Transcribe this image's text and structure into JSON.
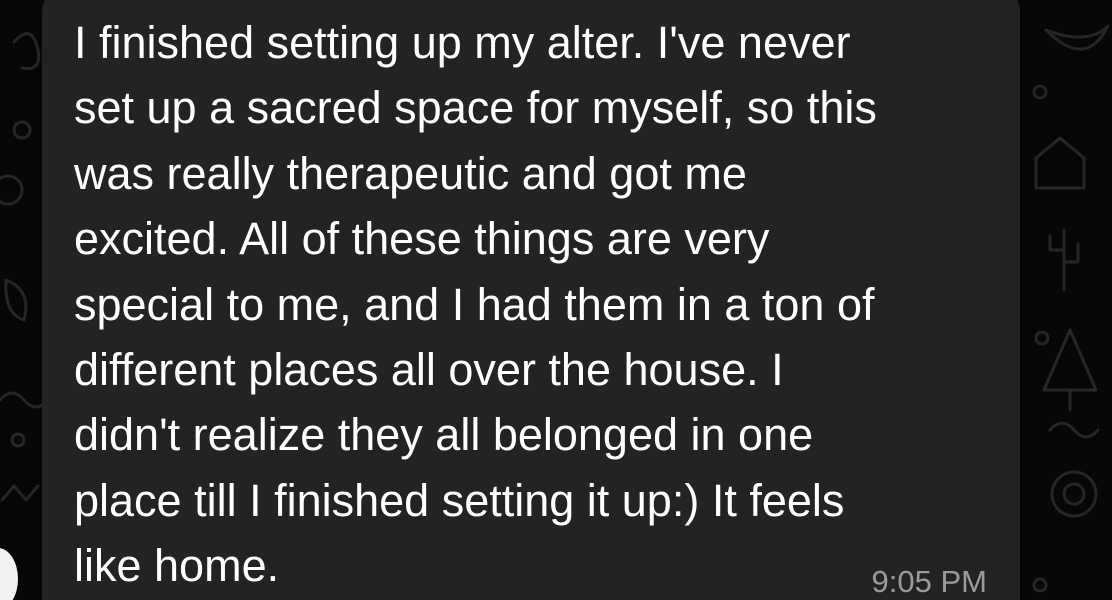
{
  "chat": {
    "message": {
      "lines": [
        "I finished setting up my alter. I've never",
        "set up a sacred space for myself, so this",
        "was really therapeutic and got me",
        "excited. All of these things are very",
        "special to me, and I had them in a ton of",
        "different places all over the house. I",
        "didn't realize they all belonged in one",
        "place till I finished setting it up:) It feels",
        "like home."
      ],
      "time": "9:05 PM"
    }
  },
  "colors": {
    "background": "#070707",
    "bubble": "#232323",
    "text": "#ffffff",
    "timestamp": "#9a9a9a",
    "wallpaper_doodles": "#262626"
  },
  "icons": [
    "wallpaper-doodle-pattern",
    "sender-avatar"
  ]
}
